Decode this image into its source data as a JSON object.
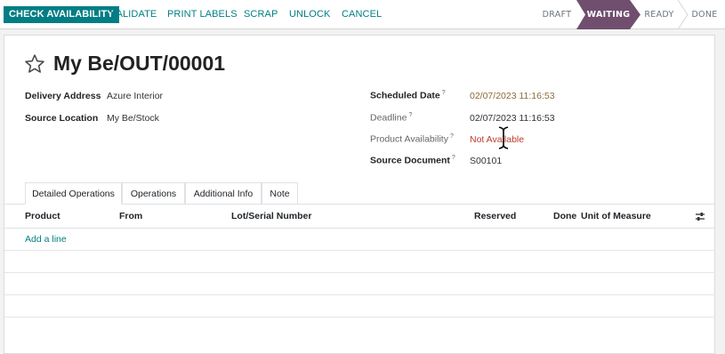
{
  "toolbar": {
    "check_availability": "CHECK AVAILABILITY",
    "validate": "VALIDATE",
    "print_labels": "PRINT LABELS",
    "scrap": "SCRAP",
    "unlock": "UNLOCK",
    "cancel": "CANCEL"
  },
  "statusbar": {
    "stages": [
      "DRAFT",
      "WAITING",
      "READY",
      "DONE"
    ],
    "active": "WAITING",
    "active_color": "#6f4e6e"
  },
  "record": {
    "title": "My Be/OUT/00001",
    "delivery_address_label": "Delivery Address",
    "delivery_address": "Azure Interior",
    "source_location_label": "Source Location",
    "source_location": "My Be/Stock",
    "scheduled_date_label": "Scheduled Date",
    "scheduled_date": "02/07/2023 11:16:53",
    "deadline_label": "Deadline",
    "deadline": "02/07/2023 11:16:53",
    "product_availability_label": "Product Availability",
    "product_availability": "Not Available",
    "source_document_label": "Source Document",
    "source_document": "S00101",
    "help_mark": "?"
  },
  "tabs": [
    "Detailed Operations",
    "Operations",
    "Additional Info",
    "Note"
  ],
  "table": {
    "columns": {
      "product": "Product",
      "from": "From",
      "lot": "Lot/Serial Number",
      "reserved": "Reserved",
      "done": "Done",
      "uom": "Unit of Measure"
    },
    "add_line": "Add a line"
  },
  "colors": {
    "primary": "#017e84",
    "date_warning": "#8a6d3b",
    "not_available": "#c0392b"
  }
}
